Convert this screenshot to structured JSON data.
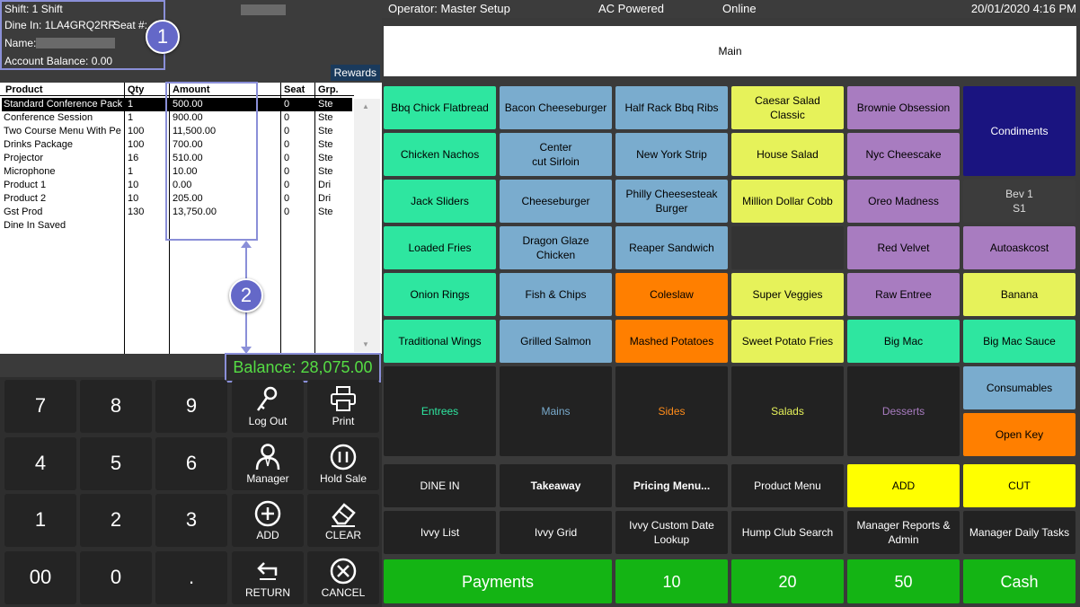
{
  "left_header": {
    "shift": "Shift: 1 Shift",
    "dine_in": "Dine In: 1LA4GRQ2RR",
    "seat": "Seat #:",
    "name_label": "Name:",
    "account_balance": "Account Balance: 0.00",
    "rewards": "Rewards"
  },
  "annotations": {
    "one": "1",
    "two": "2"
  },
  "order_table": {
    "headers": {
      "product": "Product",
      "qty": "Qty",
      "amount": "Amount",
      "seat": "Seat",
      "grp": "Grp."
    },
    "rows": [
      {
        "product": "Standard Conference Pack",
        "qty": "1",
        "amount": "500.00",
        "seat": "0",
        "grp": "Ste"
      },
      {
        "product": "Conference Session",
        "qty": "1",
        "amount": "900.00",
        "seat": "0",
        "grp": "Ste"
      },
      {
        "product": "Two Course Menu With Pe",
        "qty": "100",
        "amount": "11,500.00",
        "seat": "0",
        "grp": "Ste"
      },
      {
        "product": "Drinks Package",
        "qty": "100",
        "amount": "700.00",
        "seat": "0",
        "grp": "Ste"
      },
      {
        "product": "Projector",
        "qty": "16",
        "amount": "510.00",
        "seat": "0",
        "grp": "Ste"
      },
      {
        "product": "Microphone",
        "qty": "1",
        "amount": "10.00",
        "seat": "0",
        "grp": "Ste"
      },
      {
        "product": "Product 1",
        "qty": "10",
        "amount": "0.00",
        "seat": "0",
        "grp": "Dri"
      },
      {
        "product": "Product 2",
        "qty": "10",
        "amount": "205.00",
        "seat": "0",
        "grp": "Dri"
      },
      {
        "product": "Gst Prod",
        "qty": "130",
        "amount": "13,750.00",
        "seat": "0",
        "grp": "Ste"
      },
      {
        "product": "Dine In Saved",
        "qty": "",
        "amount": "",
        "seat": "",
        "grp": ""
      }
    ]
  },
  "balance": "Balance: 28,075.00",
  "keypad": {
    "numbers": [
      "7",
      "8",
      "9",
      "4",
      "5",
      "6",
      "1",
      "2",
      "3",
      "00",
      "0",
      "."
    ],
    "functions": [
      "Log Out",
      "Print",
      "Manager",
      "Hold Sale",
      "ADD",
      "CLEAR",
      "RETURN",
      "CANCEL"
    ]
  },
  "top_header": {
    "operator": "Operator: Master Setup",
    "power": "AC Powered",
    "status": "Online",
    "datetime": "20/01/2020 4:16 PM"
  },
  "main_bar": "Main",
  "products": {
    "rows": [
      [
        "Bbq Chick Flatbread",
        "Bacon Cheeseburger",
        "Half Rack Bbq Ribs",
        "Caesar Salad\nClassic",
        "Brownie Obsession"
      ],
      [
        "Chicken Nachos",
        "Center\ncut Sirloin",
        "New York Strip",
        "House Salad",
        "Nyc Cheescake"
      ],
      [
        "Jack Sliders",
        "Cheeseburger",
        "Philly Cheesesteak\nBurger",
        "Million Dollar Cobb",
        "Oreo Madness"
      ],
      [
        "Loaded Fries",
        "Dragon Glaze\nChicken",
        "Reaper Sandwich",
        "",
        "Red Velvet"
      ],
      [
        "Onion Rings",
        "Fish & Chips",
        "Coleslaw",
        "Super Veggies",
        "Raw Entree"
      ],
      [
        "Traditional Wings",
        "Grilled Salmon",
        "Mashed Potatoes",
        "Sweet Potato Fries",
        "Big Mac"
      ]
    ],
    "side_col": [
      "Condiments",
      "Bev 1\nS1",
      "Autoaskcost",
      "Banana",
      "Big Mac Sauce"
    ]
  },
  "categories": {
    "items": [
      "Entrees",
      "Mains",
      "Sides",
      "Salads",
      "Desserts"
    ],
    "colors": [
      "#2ee6a0",
      "#7aacce",
      "#ff8c1a",
      "#e6f25a",
      "#a87cc0"
    ],
    "consumables": "Consumables",
    "open_key": "Open Key"
  },
  "function_row1": [
    "DINE IN",
    "Takeaway",
    "Pricing Menu...",
    "Product Menu",
    "ADD",
    "CUT"
  ],
  "function_row2": [
    "Ivvy List",
    "Ivvy Grid",
    "Ivvy Custom Date\nLookup",
    "Hump Club Search",
    "Manager Reports &\nAdmin",
    "Manager Daily Tasks"
  ],
  "payment_row": [
    "Payments",
    "10",
    "20",
    "50",
    "Cash"
  ],
  "colors": {
    "teal": "#2ee6a0",
    "blue": "#7aacce",
    "yellow": "#e6f25a",
    "purple": "#a87cc0",
    "orange": "#ff7f00",
    "navy": "#1a1480",
    "bright_yellow": "#ffff00",
    "green": "#14b414",
    "balance_text": "#55dd44",
    "annotation": "#6468c8"
  }
}
